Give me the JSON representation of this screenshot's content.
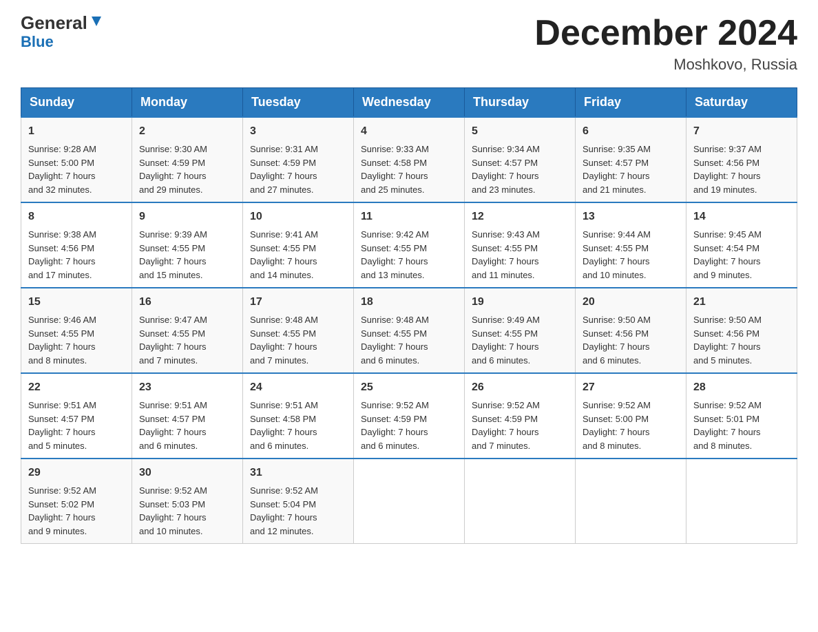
{
  "header": {
    "logo_general": "General",
    "logo_blue": "Blue",
    "month_title": "December 2024",
    "location": "Moshkovo, Russia"
  },
  "days_of_week": [
    "Sunday",
    "Monday",
    "Tuesday",
    "Wednesday",
    "Thursday",
    "Friday",
    "Saturday"
  ],
  "weeks": [
    [
      {
        "day": "1",
        "sunrise": "9:28 AM",
        "sunset": "5:00 PM",
        "daylight_h": "7",
        "daylight_m": "32"
      },
      {
        "day": "2",
        "sunrise": "9:30 AM",
        "sunset": "4:59 PM",
        "daylight_h": "7",
        "daylight_m": "29"
      },
      {
        "day": "3",
        "sunrise": "9:31 AM",
        "sunset": "4:59 PM",
        "daylight_h": "7",
        "daylight_m": "27"
      },
      {
        "day": "4",
        "sunrise": "9:33 AM",
        "sunset": "4:58 PM",
        "daylight_h": "7",
        "daylight_m": "25"
      },
      {
        "day": "5",
        "sunrise": "9:34 AM",
        "sunset": "4:57 PM",
        "daylight_h": "7",
        "daylight_m": "23"
      },
      {
        "day": "6",
        "sunrise": "9:35 AM",
        "sunset": "4:57 PM",
        "daylight_h": "7",
        "daylight_m": "21"
      },
      {
        "day": "7",
        "sunrise": "9:37 AM",
        "sunset": "4:56 PM",
        "daylight_h": "7",
        "daylight_m": "19"
      }
    ],
    [
      {
        "day": "8",
        "sunrise": "9:38 AM",
        "sunset": "4:56 PM",
        "daylight_h": "7",
        "daylight_m": "17"
      },
      {
        "day": "9",
        "sunrise": "9:39 AM",
        "sunset": "4:55 PM",
        "daylight_h": "7",
        "daylight_m": "15"
      },
      {
        "day": "10",
        "sunrise": "9:41 AM",
        "sunset": "4:55 PM",
        "daylight_h": "7",
        "daylight_m": "14"
      },
      {
        "day": "11",
        "sunrise": "9:42 AM",
        "sunset": "4:55 PM",
        "daylight_h": "7",
        "daylight_m": "13"
      },
      {
        "day": "12",
        "sunrise": "9:43 AM",
        "sunset": "4:55 PM",
        "daylight_h": "7",
        "daylight_m": "11"
      },
      {
        "day": "13",
        "sunrise": "9:44 AM",
        "sunset": "4:55 PM",
        "daylight_h": "7",
        "daylight_m": "10"
      },
      {
        "day": "14",
        "sunrise": "9:45 AM",
        "sunset": "4:54 PM",
        "daylight_h": "7",
        "daylight_m": "9"
      }
    ],
    [
      {
        "day": "15",
        "sunrise": "9:46 AM",
        "sunset": "4:55 PM",
        "daylight_h": "7",
        "daylight_m": "8"
      },
      {
        "day": "16",
        "sunrise": "9:47 AM",
        "sunset": "4:55 PM",
        "daylight_h": "7",
        "daylight_m": "7"
      },
      {
        "day": "17",
        "sunrise": "9:48 AM",
        "sunset": "4:55 PM",
        "daylight_h": "7",
        "daylight_m": "7"
      },
      {
        "day": "18",
        "sunrise": "9:48 AM",
        "sunset": "4:55 PM",
        "daylight_h": "7",
        "daylight_m": "6"
      },
      {
        "day": "19",
        "sunrise": "9:49 AM",
        "sunset": "4:55 PM",
        "daylight_h": "7",
        "daylight_m": "6"
      },
      {
        "day": "20",
        "sunrise": "9:50 AM",
        "sunset": "4:56 PM",
        "daylight_h": "7",
        "daylight_m": "6"
      },
      {
        "day": "21",
        "sunrise": "9:50 AM",
        "sunset": "4:56 PM",
        "daylight_h": "7",
        "daylight_m": "5"
      }
    ],
    [
      {
        "day": "22",
        "sunrise": "9:51 AM",
        "sunset": "4:57 PM",
        "daylight_h": "7",
        "daylight_m": "5"
      },
      {
        "day": "23",
        "sunrise": "9:51 AM",
        "sunset": "4:57 PM",
        "daylight_h": "7",
        "daylight_m": "6"
      },
      {
        "day": "24",
        "sunrise": "9:51 AM",
        "sunset": "4:58 PM",
        "daylight_h": "7",
        "daylight_m": "6"
      },
      {
        "day": "25",
        "sunrise": "9:52 AM",
        "sunset": "4:59 PM",
        "daylight_h": "7",
        "daylight_m": "6"
      },
      {
        "day": "26",
        "sunrise": "9:52 AM",
        "sunset": "4:59 PM",
        "daylight_h": "7",
        "daylight_m": "7"
      },
      {
        "day": "27",
        "sunrise": "9:52 AM",
        "sunset": "5:00 PM",
        "daylight_h": "7",
        "daylight_m": "8"
      },
      {
        "day": "28",
        "sunrise": "9:52 AM",
        "sunset": "5:01 PM",
        "daylight_h": "7",
        "daylight_m": "8"
      }
    ],
    [
      {
        "day": "29",
        "sunrise": "9:52 AM",
        "sunset": "5:02 PM",
        "daylight_h": "7",
        "daylight_m": "9"
      },
      {
        "day": "30",
        "sunrise": "9:52 AM",
        "sunset": "5:03 PM",
        "daylight_h": "7",
        "daylight_m": "10"
      },
      {
        "day": "31",
        "sunrise": "9:52 AM",
        "sunset": "5:04 PM",
        "daylight_h": "7",
        "daylight_m": "12"
      },
      null,
      null,
      null,
      null
    ]
  ]
}
